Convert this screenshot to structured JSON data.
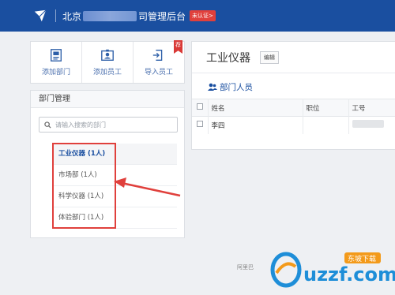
{
  "header": {
    "company_prefix": "北京",
    "company_suffix": "司管理后台",
    "cert_badge": "未认证>",
    "colors": {
      "bar": "#1a4fa0",
      "badge": "#e0403c"
    }
  },
  "actions": [
    {
      "label": "添加部门",
      "icon": "add-department-icon"
    },
    {
      "label": "添加员工",
      "icon": "add-employee-icon"
    },
    {
      "label": "导入员工",
      "icon": "import-employee-icon",
      "ribbon": "荐"
    }
  ],
  "dept": {
    "title": "部门管理",
    "search_placeholder": "请输入搜索的部门",
    "items": [
      {
        "label": "工业仪器 (1人)",
        "active": true
      },
      {
        "label": "市场部 (1人)",
        "active": false
      },
      {
        "label": "科学仪器 (1人)",
        "active": false
      },
      {
        "label": "体验部门 (1人)",
        "active": false
      }
    ]
  },
  "main": {
    "title": "工业仪器",
    "edit_label": "编辑",
    "members_label": "部门人员",
    "columns": [
      "姓名",
      "职位",
      "工号"
    ],
    "rows": [
      {
        "name": "李四",
        "position": ""
      }
    ]
  },
  "footer": {
    "text": "阿里巴"
  },
  "watermark": {
    "brand": "uzzf.com",
    "tag": "东坡下载"
  }
}
